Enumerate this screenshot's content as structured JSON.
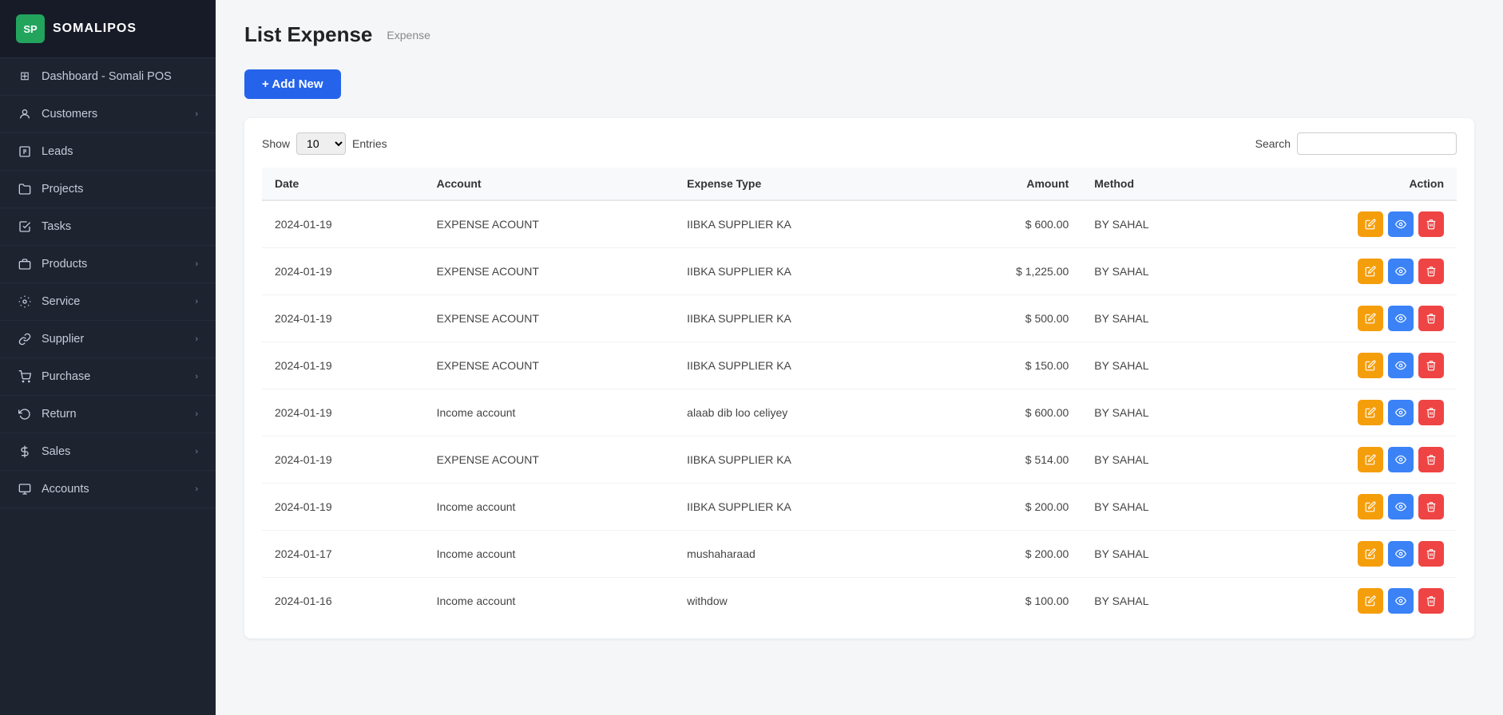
{
  "app": {
    "logo_initials": "SP",
    "logo_name": "SOMALIPOS"
  },
  "sidebar": {
    "items": [
      {
        "id": "dashboard",
        "label": "Dashboard - Somali POS",
        "icon": "dashboard-icon",
        "has_chevron": false
      },
      {
        "id": "customers",
        "label": "Customers",
        "icon": "customers-icon",
        "has_chevron": true
      },
      {
        "id": "leads",
        "label": "Leads",
        "icon": "leads-icon",
        "has_chevron": false
      },
      {
        "id": "projects",
        "label": "Projects",
        "icon": "projects-icon",
        "has_chevron": false
      },
      {
        "id": "tasks",
        "label": "Tasks",
        "icon": "tasks-icon",
        "has_chevron": false
      },
      {
        "id": "products",
        "label": "Products",
        "icon": "products-icon",
        "has_chevron": true
      },
      {
        "id": "service",
        "label": "Service",
        "icon": "service-icon",
        "has_chevron": true
      },
      {
        "id": "supplier",
        "label": "Supplier",
        "icon": "supplier-icon",
        "has_chevron": true
      },
      {
        "id": "purchase",
        "label": "Purchase",
        "icon": "purchase-icon",
        "has_chevron": true
      },
      {
        "id": "return",
        "label": "Return",
        "icon": "return-icon",
        "has_chevron": true
      },
      {
        "id": "sales",
        "label": "Sales",
        "icon": "sales-icon",
        "has_chevron": true
      },
      {
        "id": "accounts",
        "label": "Accounts",
        "icon": "accounts-icon",
        "has_chevron": true
      }
    ]
  },
  "page": {
    "title": "List Expense",
    "breadcrumb": "Expense",
    "add_button": "+ Add New"
  },
  "table_controls": {
    "show_label": "Show",
    "entries_label": "Entries",
    "entries_value": "10",
    "search_label": "Search",
    "search_placeholder": ""
  },
  "table": {
    "columns": [
      "Date",
      "Account",
      "Expense Type",
      "Amount",
      "Method",
      "Action"
    ],
    "rows": [
      {
        "date": "2024-01-19",
        "account": "EXPENSE ACOUNT",
        "expense_type": "IIBKA SUPPLIER KA",
        "amount": "$ 600.00",
        "method": "BY SAHAL"
      },
      {
        "date": "2024-01-19",
        "account": "EXPENSE ACOUNT",
        "expense_type": "IIBKA SUPPLIER KA",
        "amount": "$ 1,225.00",
        "method": "BY SAHAL"
      },
      {
        "date": "2024-01-19",
        "account": "EXPENSE ACOUNT",
        "expense_type": "IIBKA SUPPLIER KA",
        "amount": "$ 500.00",
        "method": "BY SAHAL"
      },
      {
        "date": "2024-01-19",
        "account": "EXPENSE ACOUNT",
        "expense_type": "IIBKA SUPPLIER KA",
        "amount": "$ 150.00",
        "method": "BY SAHAL"
      },
      {
        "date": "2024-01-19",
        "account": "Income account",
        "expense_type": "alaab dib loo celiyey",
        "amount": "$ 600.00",
        "method": "BY SAHAL"
      },
      {
        "date": "2024-01-19",
        "account": "EXPENSE ACOUNT",
        "expense_type": "IIBKA SUPPLIER KA",
        "amount": "$ 514.00",
        "method": "BY SAHAL"
      },
      {
        "date": "2024-01-19",
        "account": "Income account",
        "expense_type": "IIBKA SUPPLIER KA",
        "amount": "$ 200.00",
        "method": "BY SAHAL"
      },
      {
        "date": "2024-01-17",
        "account": "Income account",
        "expense_type": "mushaharaad",
        "amount": "$ 200.00",
        "method": "BY SAHAL"
      },
      {
        "date": "2024-01-16",
        "account": "Income account",
        "expense_type": "withdow",
        "amount": "$ 100.00",
        "method": "BY SAHAL"
      }
    ]
  },
  "icons": {
    "dashboard": "⊞",
    "customers": "👤",
    "leads": "📊",
    "projects": "📁",
    "tasks": "✅",
    "products": "📦",
    "service": "🔧",
    "supplier": "🔗",
    "purchase": "🛒",
    "return": "↩",
    "sales": "💰",
    "accounts": "🗂",
    "edit": "✏",
    "view": "👁",
    "delete": "🗑"
  }
}
